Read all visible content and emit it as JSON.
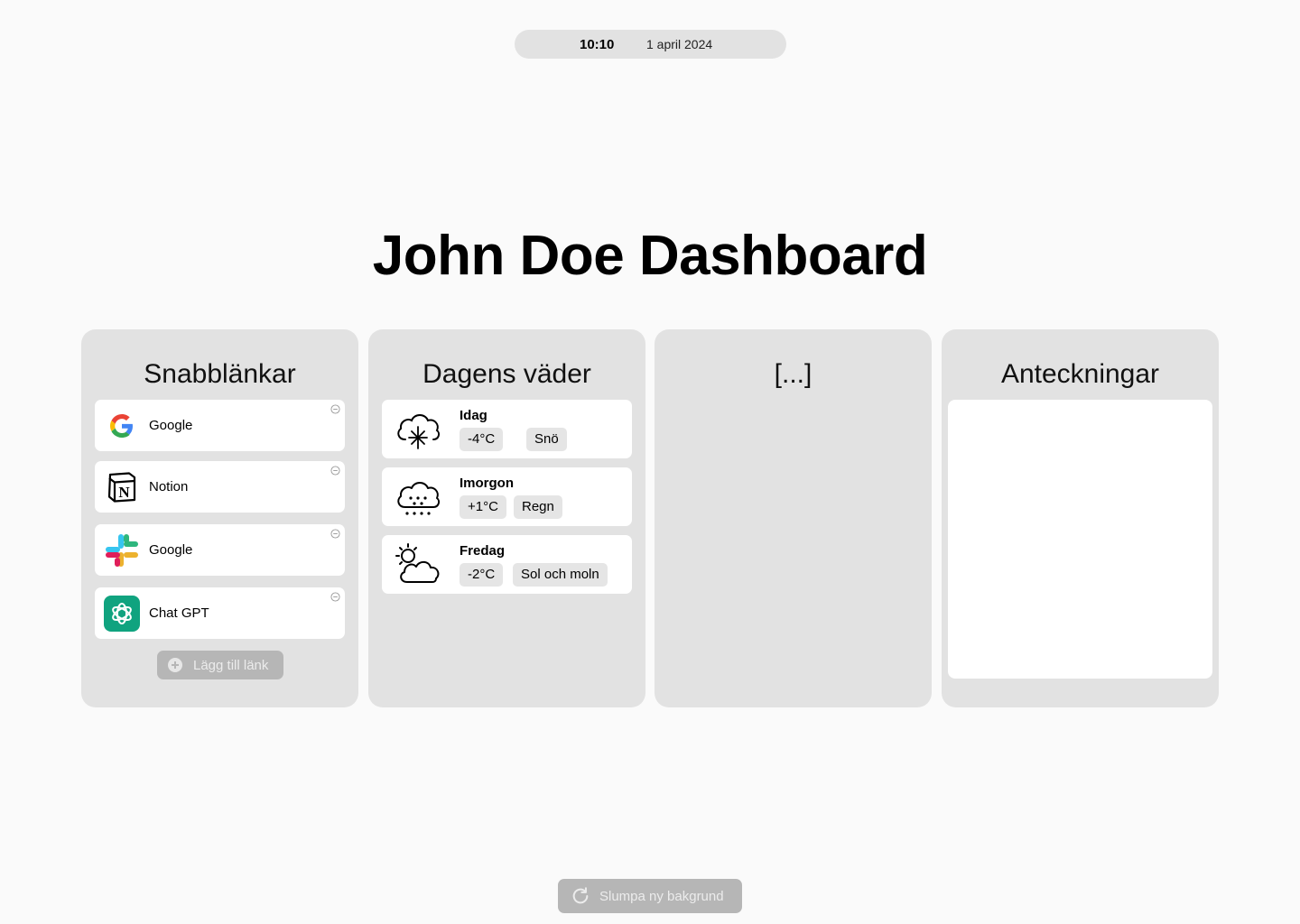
{
  "clock": {
    "time": "10:10",
    "date": "1 april 2024"
  },
  "page_title": "John Doe Dashboard",
  "quick_links": {
    "title": "Snabblänkar",
    "items": [
      {
        "label": "Google",
        "icon": "google-icon"
      },
      {
        "label": "Notion",
        "icon": "notion-icon"
      },
      {
        "label": "Google",
        "icon": "slack-icon"
      },
      {
        "label": "Chat GPT",
        "icon": "chatgpt-icon"
      }
    ],
    "add_label": "Lägg till länk"
  },
  "weather": {
    "title": "Dagens väder",
    "items": [
      {
        "day": "Idag",
        "temp": "-4°C",
        "condition": "Snö",
        "icon": "snow-cloud-icon"
      },
      {
        "day": "Imorgon",
        "temp": "+1°C",
        "condition": "Regn",
        "icon": "rain-cloud-icon"
      },
      {
        "day": "Fredag",
        "temp": "-2°C",
        "condition": "Sol och moln",
        "icon": "sun-cloud-icon"
      }
    ]
  },
  "placeholder_card": {
    "title": "[...]"
  },
  "notes": {
    "title": "Anteckningar",
    "value": ""
  },
  "footer": {
    "random_bg_label": "Slumpa ny bakgrund"
  },
  "colors": {
    "background": "#fafafa",
    "card": "#e2e2e2",
    "button": "#b6b6b6",
    "chatgpt": "#10a37f"
  }
}
